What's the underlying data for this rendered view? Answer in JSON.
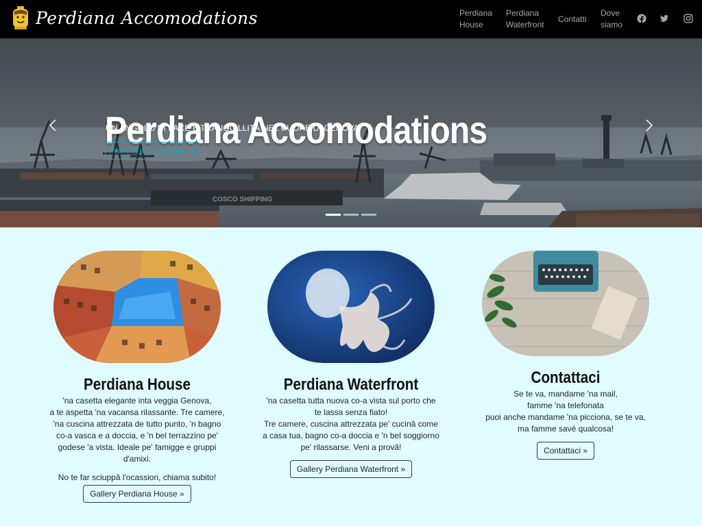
{
  "navbar": {
    "brand": "Perdiana Accomodations",
    "links": [
      {
        "line1": "Perdiana",
        "line2": "House"
      },
      {
        "line1": "Perdiana",
        "line2": "Waterfront"
      },
      {
        "line1": "Contatti",
        "line2": ""
      },
      {
        "line1": "Dove",
        "line2": "siamo"
      }
    ],
    "social": [
      "facebook-icon",
      "twitter-icon",
      "instagram-icon"
    ]
  },
  "hero": {
    "title": "Perdiana Accomodations",
    "subtitle": "UN ANGOLO DI PACE E TRANQUILLITÀ NEL CUORE DI GENOVA.",
    "cta": "Prenota il tuo soggiorno",
    "ship_text": "COSCO SHIPPING",
    "slides": 3,
    "active_slide": 1
  },
  "cards": [
    {
      "title": "Perdiana House",
      "text": [
        "'na casetta elegante inta veggia Genova,",
        "a te aspetta 'na vacansa rilassante. Tre camere,",
        "'na cuscina attrezzata de tutto punto, 'n bagno",
        "co-a vasca e a doccia, e 'n bel terrazzino pe'",
        "godese 'a vista. Ideale pe' famigge e gruppi",
        "d'amixi."
      ],
      "extra": "No te far sciuppâ l'ocassion, chiama subito!",
      "button": "Gallery Perdiana House »"
    },
    {
      "title": "Perdiana Waterfront",
      "text": [
        "'na casetta tutta nuova co-a vista sul porto che",
        "te lassa senza fiato!",
        "Tre camere, cuscina attrezzata pe' cucinâ come",
        "a casa tua, bagno co-a doccia e 'n bel soggiorno",
        "pe' rilassarse. Veni a provâ!"
      ],
      "button": "Gallery Perdiana Waterfront »"
    },
    {
      "title": "Contattaci",
      "text": [
        "Se te va, mandame 'na mail,",
        "famme 'na telefonata",
        "puoi anche mandame 'na picciona, se te va,",
        "ma famme savé qualcosa!"
      ],
      "button": "Contattaci »"
    }
  ],
  "colors": {
    "navbar": "#000000",
    "page_bg": "#e0fcff",
    "accent": "#17a2b8"
  }
}
